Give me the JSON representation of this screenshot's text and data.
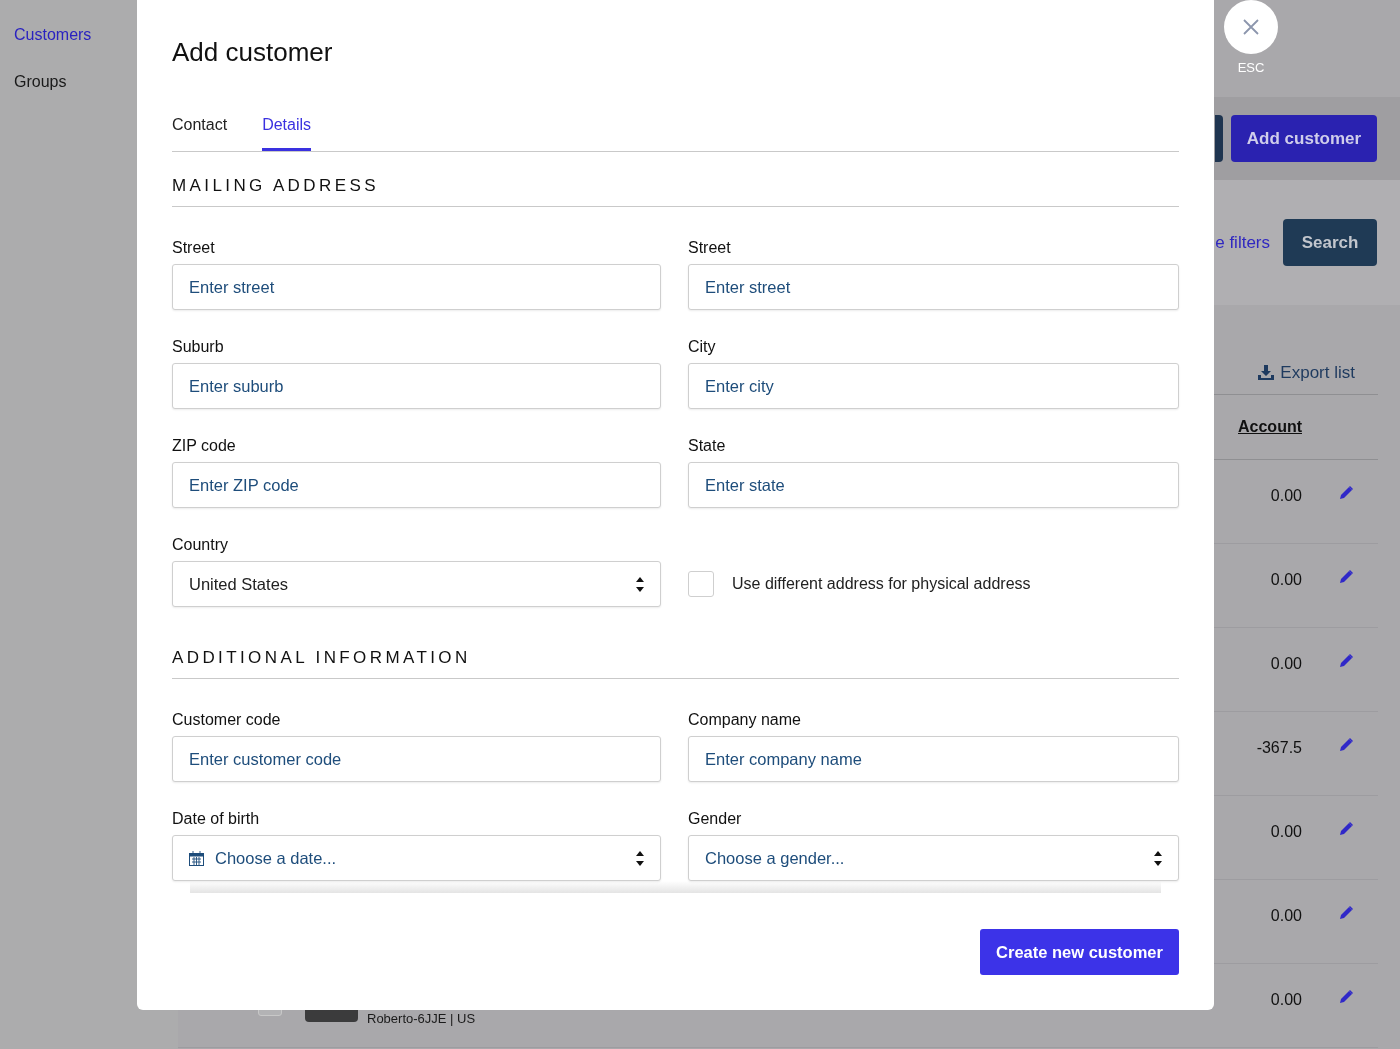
{
  "sidebar": {
    "items": [
      {
        "label": "Customers",
        "selected": true
      },
      {
        "label": "Groups",
        "selected": false
      }
    ]
  },
  "page": {
    "add_button": "Add customer",
    "filters_link": "e filters",
    "search_button": "Search",
    "export_link": "Export list",
    "table": {
      "columns": [
        "Account"
      ],
      "rows": [
        {
          "account": "0.00"
        },
        {
          "account": "0.00"
        },
        {
          "account": "0.00"
        },
        {
          "account": "-367.5"
        },
        {
          "account": "0.00"
        },
        {
          "account": "0.00"
        },
        {
          "account": "0.00",
          "customer": "Roberto-6JJE | US",
          "checked": false
        }
      ]
    }
  },
  "modal": {
    "title": "Add customer",
    "close_label": "ESC",
    "tabs": [
      {
        "label": "Contact",
        "selected": false
      },
      {
        "label": "Details",
        "selected": true
      }
    ],
    "sections": [
      {
        "heading": "MAILING ADDRESS",
        "fields": [
          {
            "kind": "text",
            "label": "Street",
            "placeholder": "Enter street"
          },
          {
            "kind": "text",
            "label": "Street",
            "placeholder": "Enter street"
          },
          {
            "kind": "text",
            "label": "Suburb",
            "placeholder": "Enter suburb"
          },
          {
            "kind": "text",
            "label": "City",
            "placeholder": "Enter city"
          },
          {
            "kind": "text",
            "label": "ZIP code",
            "placeholder": "Enter ZIP code"
          },
          {
            "kind": "text",
            "label": "State",
            "placeholder": "Enter state"
          },
          {
            "kind": "select",
            "label": "Country",
            "value": "United States"
          },
          {
            "kind": "checkbox",
            "label": "Use different address for physical address",
            "checked": false
          }
        ]
      },
      {
        "heading": "ADDITIONAL INFORMATION",
        "fields": [
          {
            "kind": "text",
            "label": "Customer code",
            "placeholder": "Enter customer code"
          },
          {
            "kind": "text",
            "label": "Company name",
            "placeholder": "Enter company name"
          },
          {
            "kind": "date",
            "label": "Date of birth",
            "placeholder": "Choose a date..."
          },
          {
            "kind": "select",
            "label": "Gender",
            "placeholder": "Choose a gender..."
          }
        ]
      }
    ],
    "submit": "Create new customer"
  }
}
